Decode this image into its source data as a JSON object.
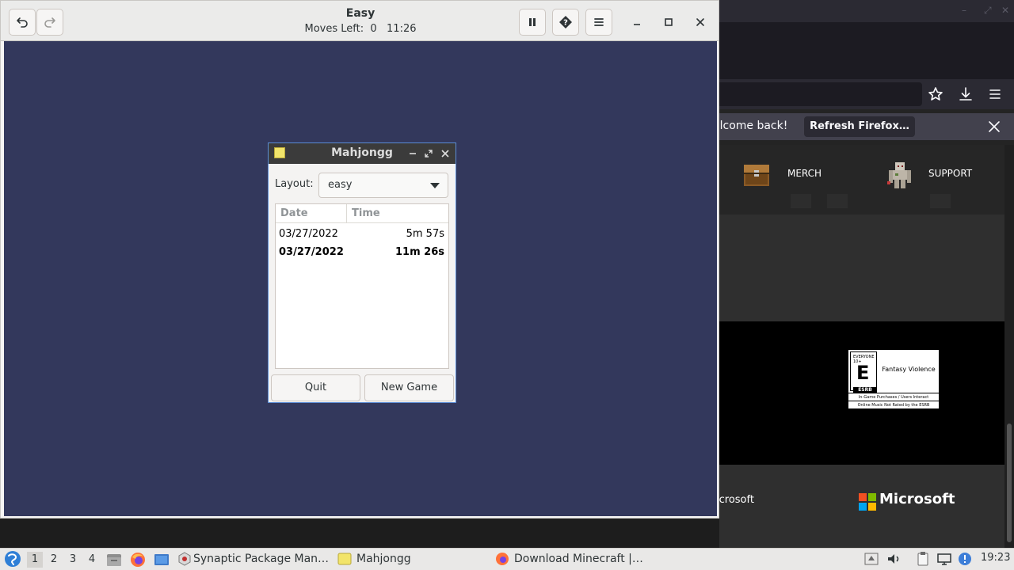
{
  "colors": {
    "board": "#33385c",
    "header": "#ebebea",
    "dialog_border": "#5b8dd6",
    "firefox_bg": "#242424",
    "taskbar": "#e9e8e7"
  },
  "main_window": {
    "title": "Easy",
    "subtitle": "Moves Left:  0   11:26",
    "icons": [
      "undo-icon",
      "redo-icon",
      "pause-icon",
      "hint-icon",
      "menu-icon",
      "minimize-icon",
      "maximize-icon",
      "close-icon"
    ]
  },
  "scores_dialog": {
    "title": "Mahjongg",
    "layout_label": "Layout:",
    "layout_value": "easy",
    "columns": {
      "date": "Date",
      "time": "Time"
    },
    "rows": [
      {
        "date": "03/27/2022",
        "time": "5m 57s",
        "highlighted": false
      },
      {
        "date": "03/27/2022",
        "time": "11m 26s",
        "highlighted": true
      }
    ],
    "quit_label": "Quit",
    "new_game_label": "New Game"
  },
  "firefox": {
    "notification_text": "elcome back!",
    "refresh_label": "Refresh Firefox…",
    "menu_merch": "MERCH",
    "menu_support": "SUPPORT",
    "esrb": {
      "top": "EVERYONE 10+",
      "rating": "E",
      "word": "ESRB",
      "descriptor": "Fantasy Violence",
      "line1": "In-Game Purchases / Users Interact",
      "line2": "Online Music Not Rated by the ESRB"
    },
    "footer_text": "icrosoft",
    "microsoft_word": "Microsoft"
  },
  "taskbar": {
    "workspaces": [
      "1",
      "2",
      "3",
      "4"
    ],
    "active_workspace": 0,
    "tasks": [
      {
        "label": "Synaptic Package Man…",
        "icon": "synaptic-icon"
      },
      {
        "label": "Mahjongg",
        "icon": "mahjongg-icon"
      },
      {
        "label": "Download Minecraft |…",
        "icon": "firefox-icon"
      }
    ],
    "clock": "19:23"
  }
}
